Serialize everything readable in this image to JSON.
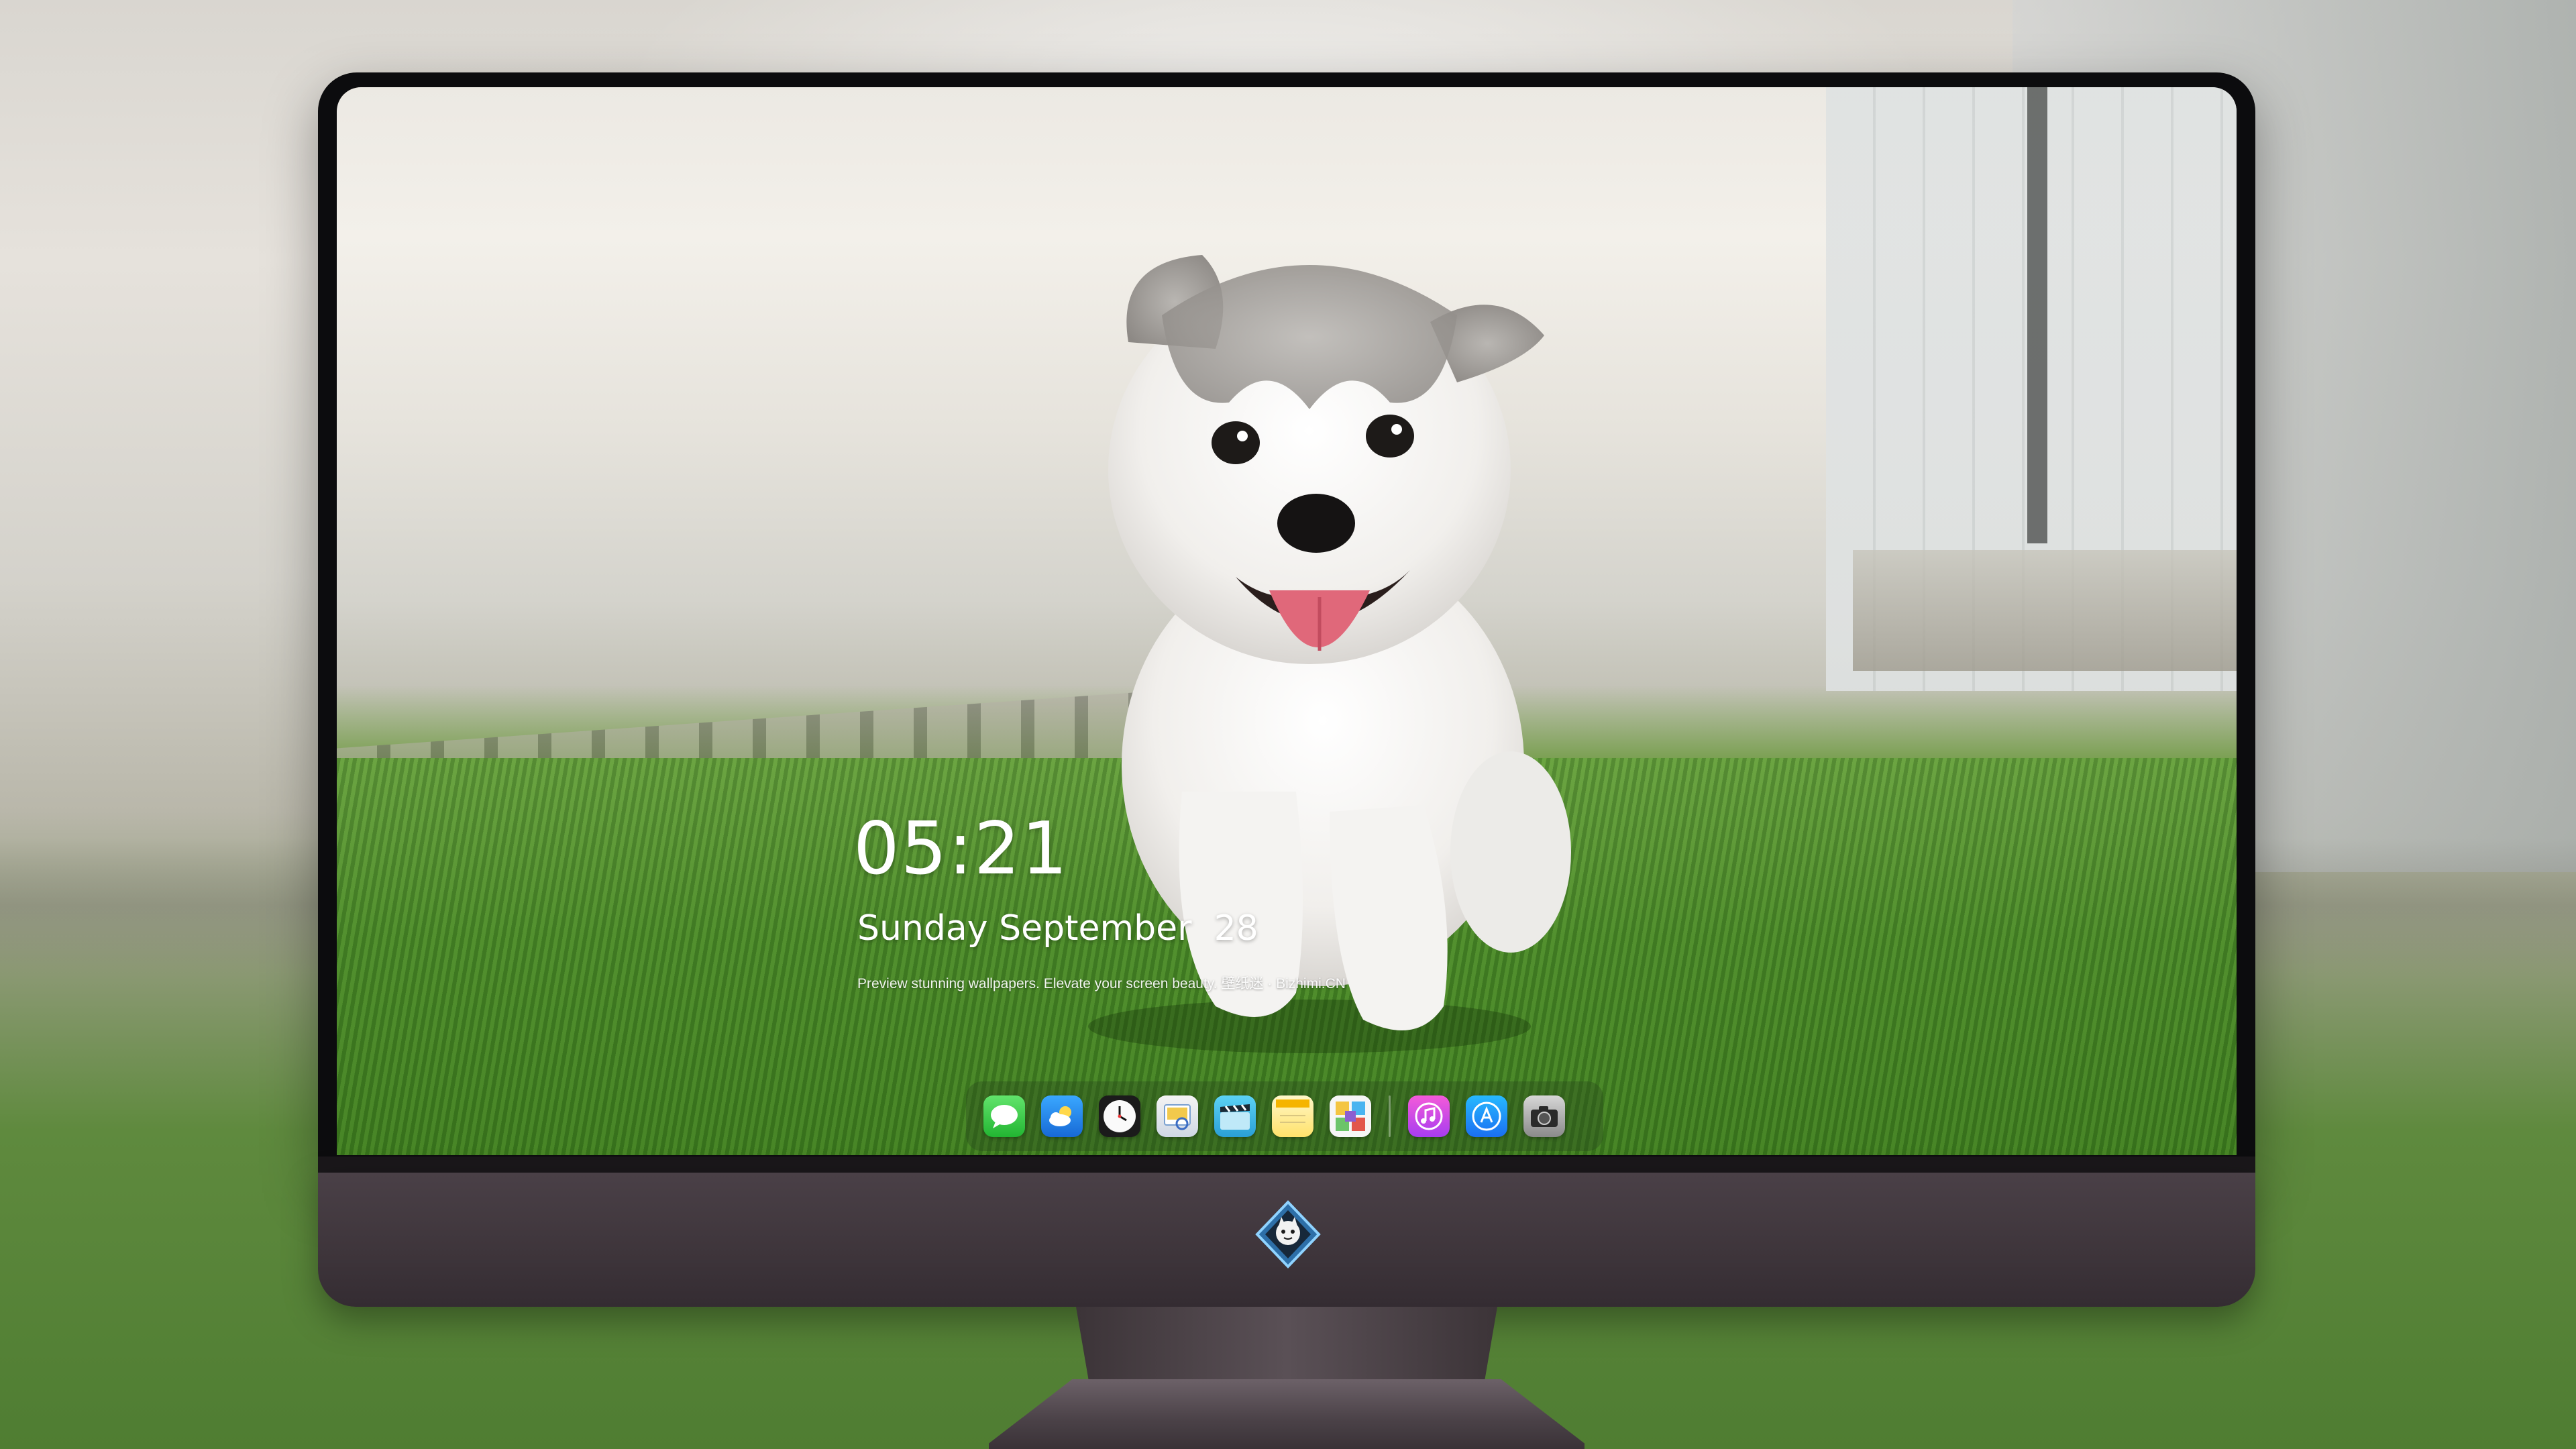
{
  "lock_screen": {
    "time": "05:21",
    "date": "Sunday September  28",
    "tagline": "Preview stunning wallpapers. Elevate your screen beauty. 壁纸迷 · Bizhimi.CN"
  },
  "dock": {
    "apps": [
      {
        "icon": "messages-icon"
      },
      {
        "icon": "weather-icon"
      },
      {
        "icon": "clock-icon"
      },
      {
        "icon": "preview-icon"
      },
      {
        "icon": "video-clapper-icon"
      },
      {
        "icon": "notes-icon"
      },
      {
        "icon": "photo-gallery-icon"
      },
      {
        "icon": "music-icon"
      },
      {
        "icon": "app-store-icon"
      },
      {
        "icon": "camera-icon"
      }
    ]
  },
  "wallpaper": {
    "subject": "husky-puppy-on-grass"
  },
  "colors": {
    "monitor_chin": "#3e353b",
    "bezel": "#0c0c0e",
    "grass": "#4c8b2a"
  }
}
